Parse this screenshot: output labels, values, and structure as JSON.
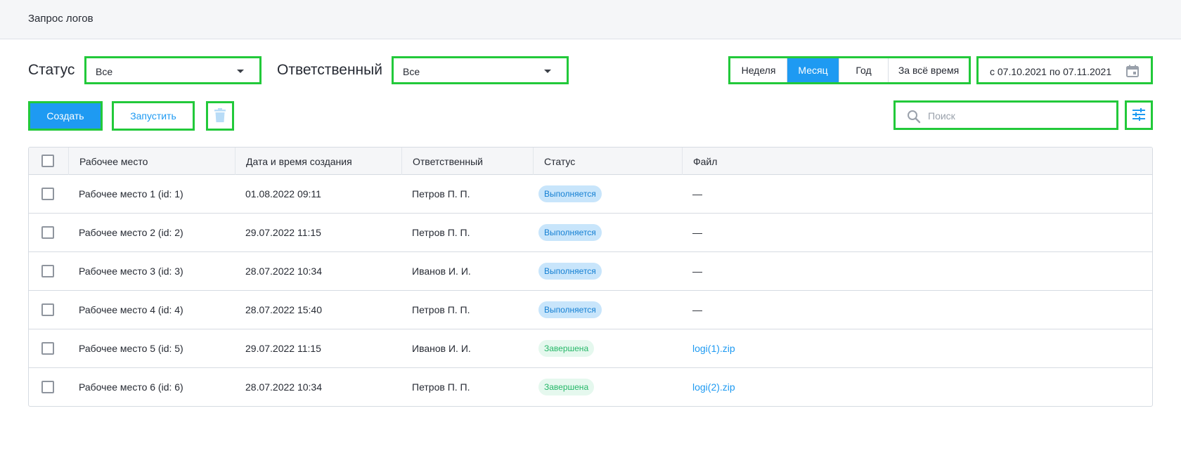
{
  "header": {
    "title": "Запрос логов"
  },
  "filters": {
    "status_label": "Статус",
    "status_value": "Все",
    "owner_label": "Ответственный",
    "owner_value": "Все"
  },
  "period": {
    "options": [
      "Неделя",
      "Месяц",
      "Год",
      "За всё время"
    ],
    "selected": "Месяц"
  },
  "date_range": {
    "value": "с 07.10.2021 по 07.11.2021"
  },
  "toolbar": {
    "create_label": "Создать",
    "run_label": "Запустить",
    "search_placeholder": "Поиск"
  },
  "table": {
    "columns": [
      "Рабочее место",
      "Дата и время создания",
      "Ответственный",
      "Статус",
      "Файл"
    ],
    "rows": [
      {
        "workplace": "Рабочее место 1 (id: 1)",
        "created": "01.08.2022 09:11",
        "owner": "Петров П. П.",
        "status": "Выполняется",
        "status_kind": "running",
        "file": "—"
      },
      {
        "workplace": "Рабочее место 2 (id: 2)",
        "created": "29.07.2022 11:15",
        "owner": "Петров П. П.",
        "status": "Выполняется",
        "status_kind": "running",
        "file": "—"
      },
      {
        "workplace": "Рабочее место 3 (id: 3)",
        "created": "28.07.2022 10:34",
        "owner": "Иванов И. И.",
        "status": "Выполняется",
        "status_kind": "running",
        "file": "—"
      },
      {
        "workplace": "Рабочее место 4 (id: 4)",
        "created": "28.07.2022 15:40",
        "owner": "Петров П. П.",
        "status": "Выполняется",
        "status_kind": "running",
        "file": "—"
      },
      {
        "workplace": "Рабочее место 5 (id: 5)",
        "created": "29.07.2022 11:15",
        "owner": "Иванов И. И.",
        "status": "Завершена",
        "status_kind": "done",
        "file": "logi(1).zip"
      },
      {
        "workplace": "Рабочее место 6 (id: 6)",
        "created": "28.07.2022 10:34",
        "owner": "Петров П. П.",
        "status": "Завершена",
        "status_kind": "done",
        "file": "logi(2).zip"
      }
    ]
  },
  "colors": {
    "accent": "#1e9af2",
    "running_badge_bg": "#c8e5fb",
    "done_badge_bg": "#e5f8ee",
    "highlight": "#22c93a"
  },
  "icons": {
    "caret": "chevron-down-icon",
    "calendar": "calendar-icon",
    "delete": "trash-icon",
    "search": "search-icon",
    "filter": "filter-sliders-icon"
  }
}
